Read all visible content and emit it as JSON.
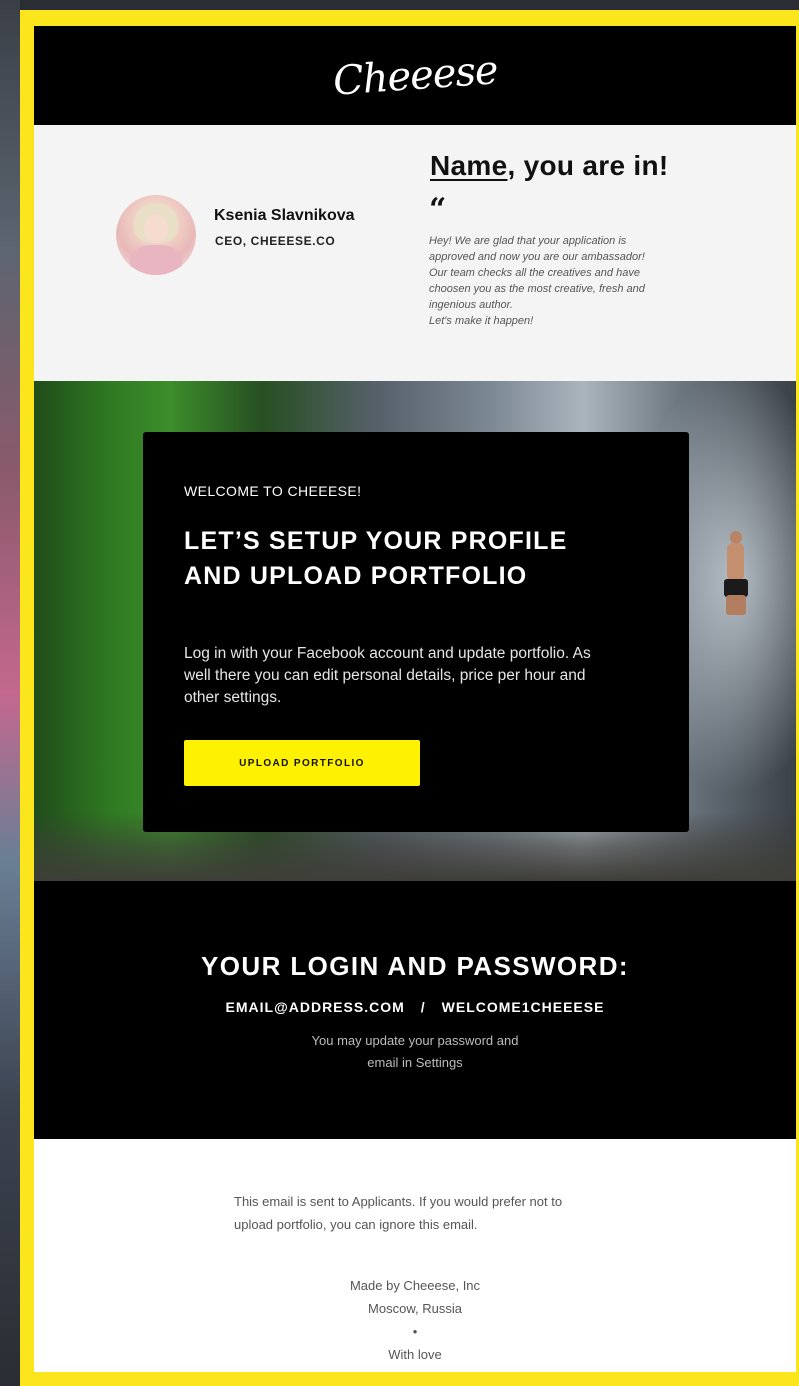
{
  "brand": {
    "logo": "Cheeese",
    "accent": "#fff200",
    "frame": "#fbe51c"
  },
  "intro": {
    "person": {
      "name": "Ksenia Slavnikova",
      "role": "CEO, CHEEESE.CO"
    },
    "headline": {
      "name": "Name",
      "rest": ", you are in!"
    },
    "quote_mark": "“",
    "message": [
      "Hey! We are glad that your application is",
      "approved and now you are our ambassador!",
      "Our team checks all the creatives and have",
      "choosen you as the most creative, fresh and",
      "ingenious author.",
      "Let's make it happen!"
    ]
  },
  "hero": {
    "kicker": "WELCOME TO CHEEESE!",
    "title": "LET’S SETUP YOUR PROFILE AND UPLOAD PORTFOLIO",
    "text": "Log in with your Facebook account and update portfolio. As well there you can edit personal details, price per hour and other settings.",
    "cta": "UPLOAD PORTFOLIO"
  },
  "credentials": {
    "title": "YOUR LOGIN AND PASSWORD:",
    "email": "EMAIL@ADDRESS.COM",
    "separator": "/",
    "password": "WELCOME1CHEEESE",
    "note_line1": "You may update your password and",
    "note_line2": "email in Settings"
  },
  "footer": {
    "note": "This email is sent to Applicants. If you would prefer not to upload portfolio, you can ignore this email.",
    "made_by": "Made by Cheeese, Inc",
    "location": "Moscow, Russia",
    "bullet": "•",
    "love": "With love"
  }
}
